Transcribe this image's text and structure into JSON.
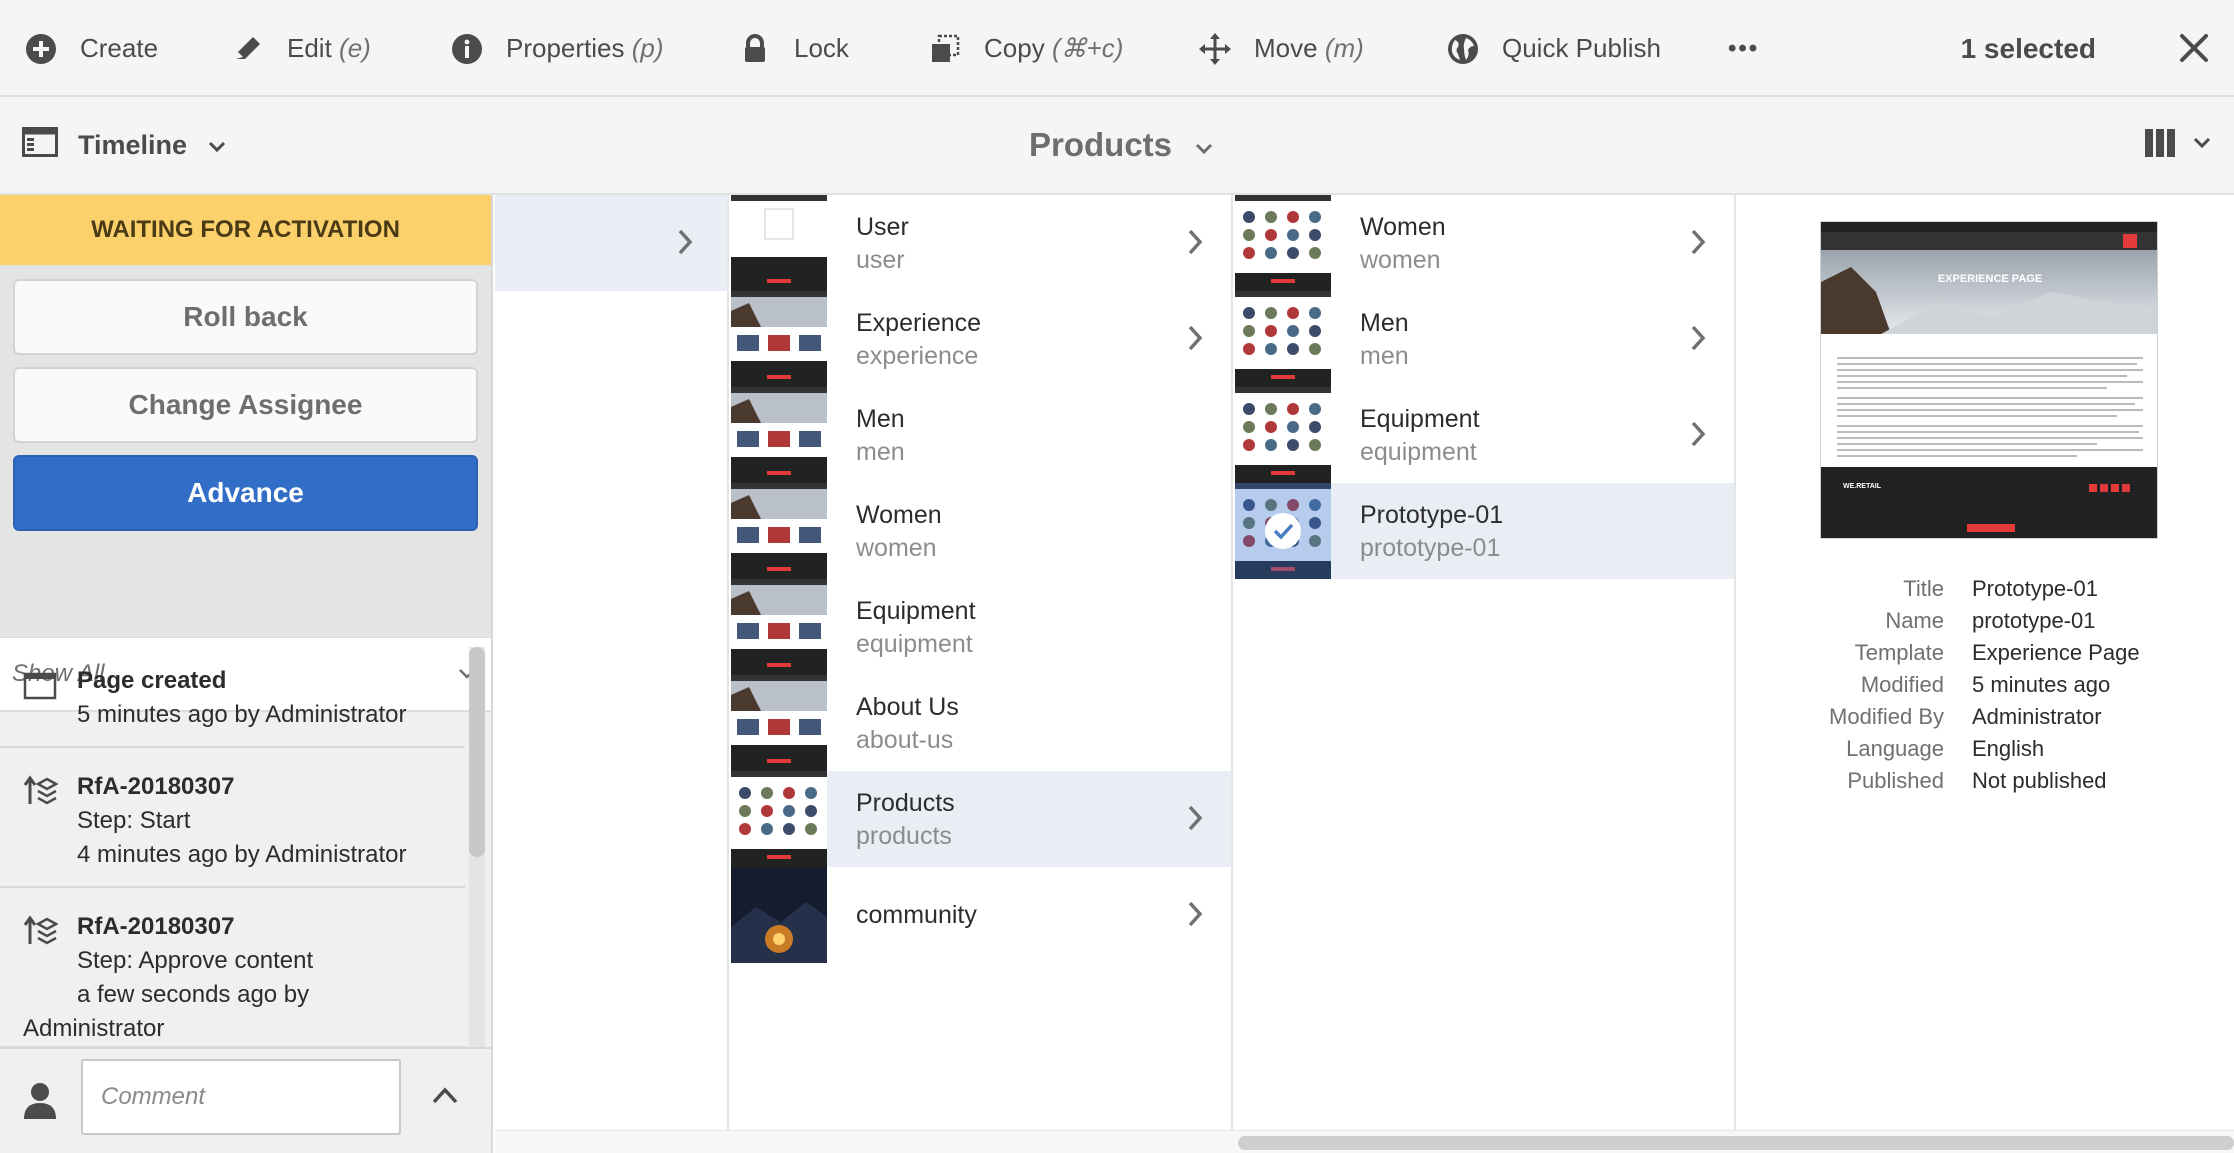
{
  "actionbar": {
    "create": "Create",
    "edit": "Edit",
    "edit_shortcut": "(e)",
    "properties": "Properties",
    "properties_shortcut": "(p)",
    "lock": "Lock",
    "copy": "Copy",
    "copy_shortcut": "(⌘+c)",
    "move": "Move",
    "move_shortcut": "(m)",
    "quick_publish": "Quick Publish",
    "more": "•••",
    "selected_count": "1 selected"
  },
  "titlebar": {
    "rail_label": "Timeline",
    "page_title": "Products"
  },
  "rail": {
    "banner": "WAITING FOR ACTIVATION",
    "buttons": {
      "rollback": "Roll back",
      "change_assignee": "Change Assignee",
      "advance": "Advance"
    },
    "filter": "Show All",
    "events": [
      {
        "title": "Page created",
        "lines": [
          "5 minutes ago by Administrator"
        ]
      },
      {
        "title": "RfA-20180307",
        "lines": [
          "Step: Start",
          "4 minutes ago by Administrator"
        ]
      },
      {
        "title": "RfA-20180307",
        "lines": [
          "Step: Approve content",
          "a few seconds ago by",
          "Administrator"
        ]
      }
    ],
    "comment_placeholder": "Comment"
  },
  "column1": [
    {
      "title": "User",
      "name": "user",
      "chevron": true,
      "thumb": "page"
    },
    {
      "title": "Experience",
      "name": "experience",
      "chevron": true,
      "thumb": "experience"
    },
    {
      "title": "Men",
      "name": "men",
      "chevron": false,
      "thumb": "experience"
    },
    {
      "title": "Women",
      "name": "women",
      "chevron": false,
      "thumb": "experience"
    },
    {
      "title": "Equipment",
      "name": "equipment",
      "chevron": false,
      "thumb": "experience"
    },
    {
      "title": "About Us",
      "name": "about-us",
      "chevron": false,
      "thumb": "experience"
    },
    {
      "title": "Products",
      "name": "products",
      "chevron": true,
      "thumb": "products"
    },
    {
      "title": "community",
      "name": "",
      "chevron": true,
      "thumb": "community"
    }
  ],
  "column2": [
    {
      "title": "Women",
      "name": "women",
      "chevron": true
    },
    {
      "title": "Men",
      "name": "men",
      "chevron": true
    },
    {
      "title": "Equipment",
      "name": "equipment",
      "chevron": true
    },
    {
      "title": "Prototype-01",
      "name": "prototype-01",
      "chevron": false,
      "selected": true
    }
  ],
  "details": {
    "preview_heading": "EXPERIENCE PAGE",
    "preview_brand": "WE.RETAIL",
    "rows": [
      {
        "key": "Title",
        "value": "Prototype-01"
      },
      {
        "key": "Name",
        "value": "prototype-01"
      },
      {
        "key": "Template",
        "value": "Experience Page"
      },
      {
        "key": "Modified",
        "value": "5 minutes ago"
      },
      {
        "key": "Modified By",
        "value": "Administrator"
      },
      {
        "key": "Language",
        "value": "English"
      },
      {
        "key": "Published",
        "value": "Not published"
      }
    ]
  },
  "colors": {
    "banner": "#fcd16b",
    "primary": "#326ec8",
    "selected_row": "#e9eef5",
    "icon": "#4b4b4b"
  }
}
